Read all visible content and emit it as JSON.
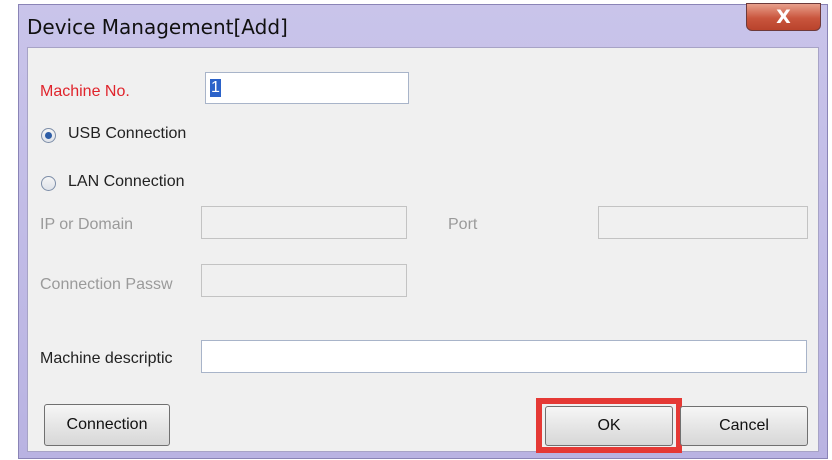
{
  "window": {
    "title": "Device Management[Add]",
    "close_glyph": "X"
  },
  "form": {
    "machine_no_label": "Machine No.",
    "machine_no_value": "1",
    "usb_label": "USB Connection",
    "usb_selected": true,
    "lan_label": "LAN Connection",
    "lan_selected": false,
    "ip_label": "IP or Domain",
    "ip_value": "",
    "port_label": "Port",
    "port_value": "",
    "password_label": "Connection Passw",
    "password_value": "",
    "description_label": "Machine descriptic",
    "description_value": ""
  },
  "buttons": {
    "connection": "Connection",
    "ok": "OK",
    "cancel": "Cancel"
  },
  "colors": {
    "required_label": "#e0242c",
    "highlight": "#e53935"
  }
}
